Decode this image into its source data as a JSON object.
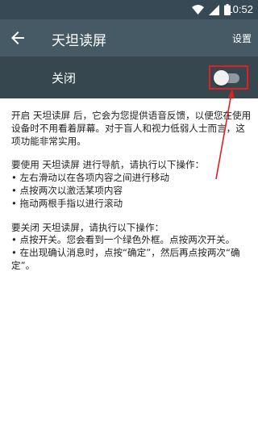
{
  "status_bar": {
    "time": "10:52"
  },
  "toolbar": {
    "title": "天坦读屏",
    "settings_label": "设置"
  },
  "switch_bar": {
    "label": "关闭",
    "toggle_state": "off"
  },
  "content": {
    "para1": "开启 天坦读屏 后，它会为您提供语音反馈，以便您在使用设备时不用看着屏幕。对于盲人和视力低弱人士而言，这项功能非常实用。",
    "para2_intro": "要使用 天坦读屏 进行导航，请执行以下操作：",
    "para2_items": [
      "• 左右滑动以在各项内容之间进行移动",
      "• 点按两次以激活某项内容",
      "• 拖动两根手指以进行滚动"
    ],
    "para3_intro": "要关闭 天坦读屏，请执行以下操作：",
    "para3_items": [
      "• 点按开关。您会看到一个绿色外框。点按两次开关。",
      "• 在出现确认消息时，点按“确定”，然后再点按两次“确定”。"
    ]
  },
  "colors": {
    "status_bar": "#364955",
    "toolbar": "#455a64",
    "switch_bar": "#37474f",
    "highlight": "#e02020"
  }
}
